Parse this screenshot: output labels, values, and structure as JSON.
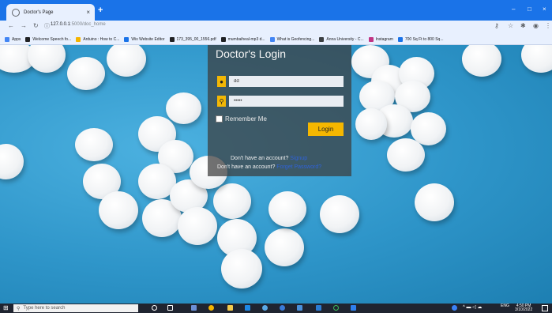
{
  "browser": {
    "tab_title": "Doctor's Page",
    "tab_close": "×",
    "new_tab": "+",
    "win_min": "–",
    "win_max": "□",
    "win_close": "×",
    "url_host": "127.0.0.1",
    "url_path": ":5000/doc_home",
    "bookmarks": [
      {
        "label": "Apps",
        "color": "#4285f4"
      },
      {
        "label": "Welcome Speech fo...",
        "color": "#202124"
      },
      {
        "label": "Arduino : How to C...",
        "color": "#f4b400"
      },
      {
        "label": "Wix Website Editor",
        "color": "#1a73e8"
      },
      {
        "label": "173_395_00_1556.pdf",
        "color": "#202124"
      },
      {
        "label": "mumbaiheal-mp3 d...",
        "color": "#202124"
      },
      {
        "label": "What is Geofencing...",
        "color": "#4285f4"
      },
      {
        "label": "Anna University - C...",
        "color": "#3c4043"
      },
      {
        "label": "Instagram",
        "color": "#c13584"
      },
      {
        "label": "700 Sq Ft to 800 Sq...",
        "color": "#1a73e8"
      }
    ]
  },
  "login": {
    "title": "Doctor's Login",
    "username_value": "dd",
    "password_value": "•••••",
    "remember_label": "Remember Me",
    "login_button": "Login",
    "account_line1_text": "Don't have an account?",
    "account_line1_link": "Signup",
    "account_line2_text": "Don't have an account?",
    "account_line2_link": "Forget Password?",
    "accent": "#f5b700"
  },
  "taskbar": {
    "search_placeholder": "Type here to search",
    "lang": "ENG",
    "time": "4:50 PM",
    "date": "3/10/2022"
  }
}
